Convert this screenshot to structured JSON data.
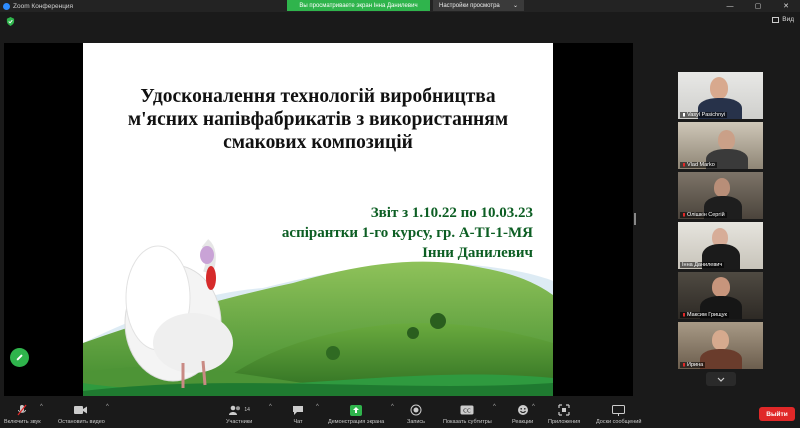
{
  "titlebar": {
    "app_title": "Zoom Конференция",
    "share_banner": "Вы просматриваете экран Інна Данилевич",
    "view_options_label": "Настройки просмотра",
    "view_options_caret": "⌄"
  },
  "view_button": {
    "label": "Вид"
  },
  "slide": {
    "title_lines": [
      "Удосконалення технологій виробництва",
      "м'ясних напівфабрикатів з використанням",
      "смакових композицій"
    ],
    "report_lines": [
      "Звіт з 1.10.22 по 10.03.23",
      "аспірантки 1-го курсу, гр. А-ТІ-1-МЯ",
      "Інни Данилевич"
    ]
  },
  "participants": [
    {
      "name": "Vasyl Pasichnyi",
      "active": false
    },
    {
      "name": "Vlad Marko",
      "active": false
    },
    {
      "name": "Олішкін Сергій",
      "active": false
    },
    {
      "name": "Інна Данилевич",
      "active": true
    },
    {
      "name": "Максим Грищук",
      "active": false
    },
    {
      "name": "Ирина",
      "active": false
    }
  ],
  "toolbar": {
    "mute_label": "Включить звук",
    "video_label": "Остановить видео",
    "participants_label": "Участники",
    "participants_count": "14",
    "chat_label": "Чат",
    "share_label": "Демонстрация экрана",
    "record_label": "Запись",
    "captions_label": "Показать субтитры",
    "reactions_label": "Реакции",
    "apps_label": "Приложения",
    "whiteboard_label": "Доски сообщений",
    "leave_label": "Выйти"
  },
  "colors": {
    "share_green": "#2fb44c",
    "leave_red": "#e02828",
    "active_speaker": "#b7d94a",
    "slide_subtitle_green": "#0c5e23"
  }
}
